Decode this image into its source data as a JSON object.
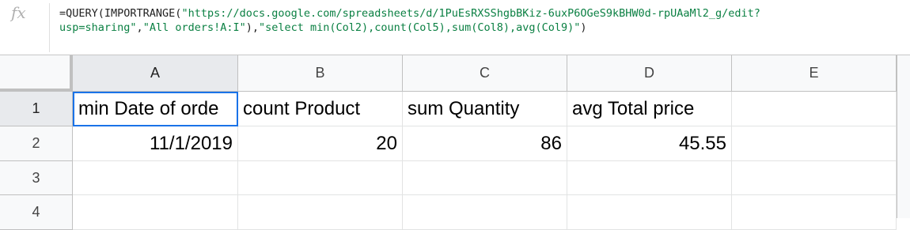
{
  "formula_bar": {
    "icon": "fx-icon",
    "icon_glyph": "fx",
    "line1_prefix": "=QUERY(IMPORTRANGE(",
    "line1_string": "\"https://docs.google.com/spreadsheets/d/1PuEsRXSShgbBKiz-6uxP6OGeS9kBHW0d-rpUAaMl2_g/edit?",
    "line2_string": "usp=sharing\"",
    "line2_mid1": ",",
    "line2_string2": "\"All orders!A:I\"",
    "line2_mid2": "),",
    "line2_string3": "\"select min(Col2),count(Col5),sum(Col8),avg(Col9)\"",
    "line2_suffix": ")"
  },
  "columns": [
    "A",
    "B",
    "C",
    "D",
    "E"
  ],
  "rows": [
    "1",
    "2",
    "3",
    "4"
  ],
  "cells": {
    "A1": "min Date of orde",
    "B1": "count Product",
    "C1": "sum Quantity",
    "D1": "avg Total price",
    "A2": "11/1/2019",
    "B2": "20",
    "C2": "86",
    "D2": "45.55"
  },
  "selection": {
    "active_cell": "A1"
  },
  "colors": {
    "selection_border": "#1a73e8",
    "string_literal": "#0b8043"
  }
}
